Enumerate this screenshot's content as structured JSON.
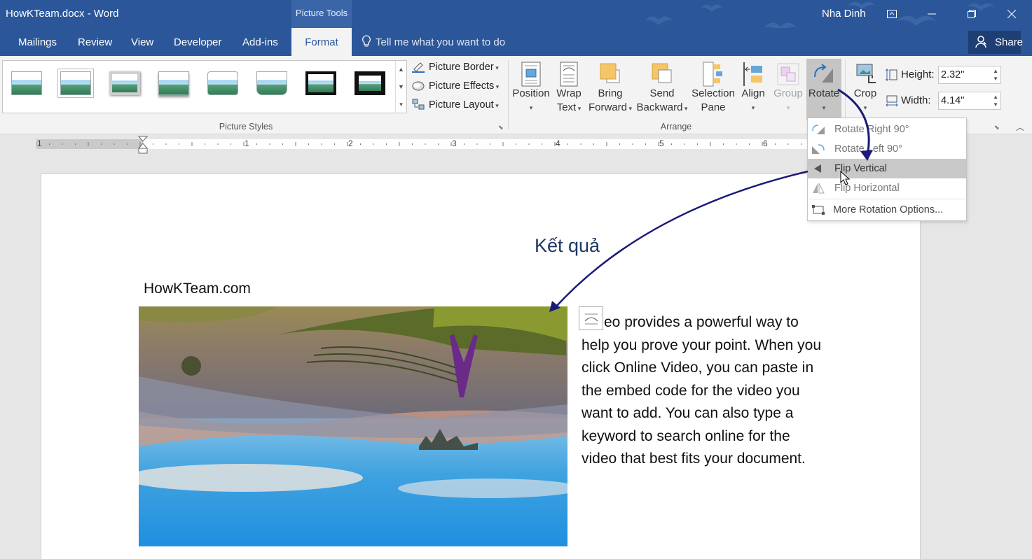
{
  "window": {
    "title": "HowKTeam.docx - Word",
    "context_tab_group": "Picture Tools",
    "user": "Nha Dinh"
  },
  "tabs": [
    {
      "label": "Mailings"
    },
    {
      "label": "Review"
    },
    {
      "label": "View"
    },
    {
      "label": "Developer"
    },
    {
      "label": "Add-ins"
    },
    {
      "label": "Format"
    }
  ],
  "tell_me": "Tell me what you want to do",
  "share": "Share",
  "ribbon": {
    "picture_styles": {
      "commands": {
        "border": "Picture Border",
        "effects": "Picture Effects",
        "layout": "Picture Layout"
      },
      "label": "Picture Styles"
    },
    "arrange": {
      "label": "Arrange",
      "position": [
        "Position"
      ],
      "wrap": [
        "Wrap",
        "Text"
      ],
      "bring": [
        "Bring",
        "Forward"
      ],
      "send": [
        "Send",
        "Backward"
      ],
      "selection": [
        "Selection",
        "Pane"
      ],
      "align": [
        "Align"
      ],
      "group": [
        "Group"
      ],
      "rotate": [
        "Rotate"
      ]
    },
    "size": {
      "crop": "Crop",
      "height_label": "Height:",
      "height_value": "2.32\"",
      "width_label": "Width:",
      "width_value": "4.14\""
    }
  },
  "rotate_menu": {
    "items": [
      {
        "label": "Rotate Right 90°"
      },
      {
        "label": "Rotate Left 90°"
      },
      {
        "label": "Flip Vertical"
      },
      {
        "label": "Flip Horizontal"
      },
      {
        "label": "More Rotation Options..."
      }
    ]
  },
  "ruler": {
    "numbers": [
      "1",
      "1",
      "2",
      "3",
      "4",
      "5",
      "6"
    ]
  },
  "document": {
    "annotation": "Kết quả",
    "site": "HowKTeam.com",
    "paragraph": "eo provides a powerful way to help you prove your point. When you click Online Video, you can paste in the embed code for the video you want to add. You can also type a keyword to search online for the video that best fits your document."
  },
  "colors": {
    "accent": "#2b579a",
    "annotation_arrow": "#1a1a7a",
    "logo": "#6a2a8a"
  }
}
